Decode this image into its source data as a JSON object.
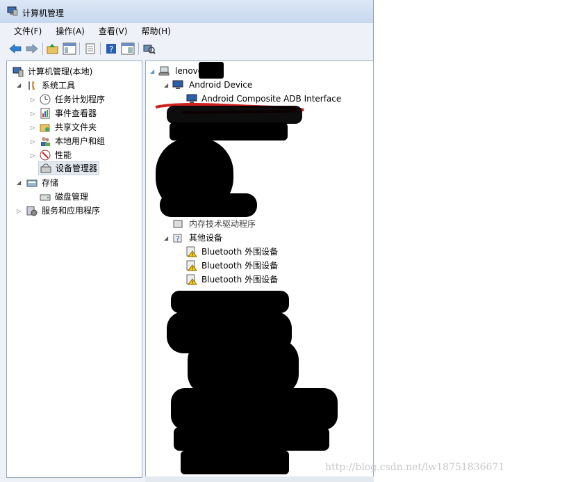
{
  "window": {
    "title": "计算机管理"
  },
  "menu": {
    "items": [
      "文件(F)",
      "操作(A)",
      "查看(V)",
      "帮助(H)"
    ]
  },
  "toolbar": {
    "icons": [
      "back-arrow-icon",
      "forward-arrow-icon",
      "up-folder-icon",
      "show-hide-tree-icon",
      "export-list-icon",
      "help-icon",
      "properties-icon",
      "scan-hardware-icon"
    ]
  },
  "tree": {
    "root": "计算机管理(本地)",
    "system_tools": "系统工具",
    "task_scheduler": "任务计划程序",
    "event_viewer": "事件查看器",
    "shared_folders": "共享文件夹",
    "local_users": "本地用户和组",
    "performance": "性能",
    "device_manager": "设备管理器",
    "storage": "存储",
    "disk_management": "磁盘管理",
    "services_apps": "服务和应用程序"
  },
  "devices": {
    "computer": "lenovo",
    "android_device": "Android Device",
    "adb_interface": "Android Composite ADB Interface",
    "memory_tech": "内存技术驱动程序",
    "other_devices": "其他设备",
    "bt1": "Bluetooth 外围设备",
    "bt2": "Bluetooth 外围设备",
    "bt3": "Bluetooth 外围设备"
  },
  "watermark": "http://blog.csdn.net/lw18751836671"
}
